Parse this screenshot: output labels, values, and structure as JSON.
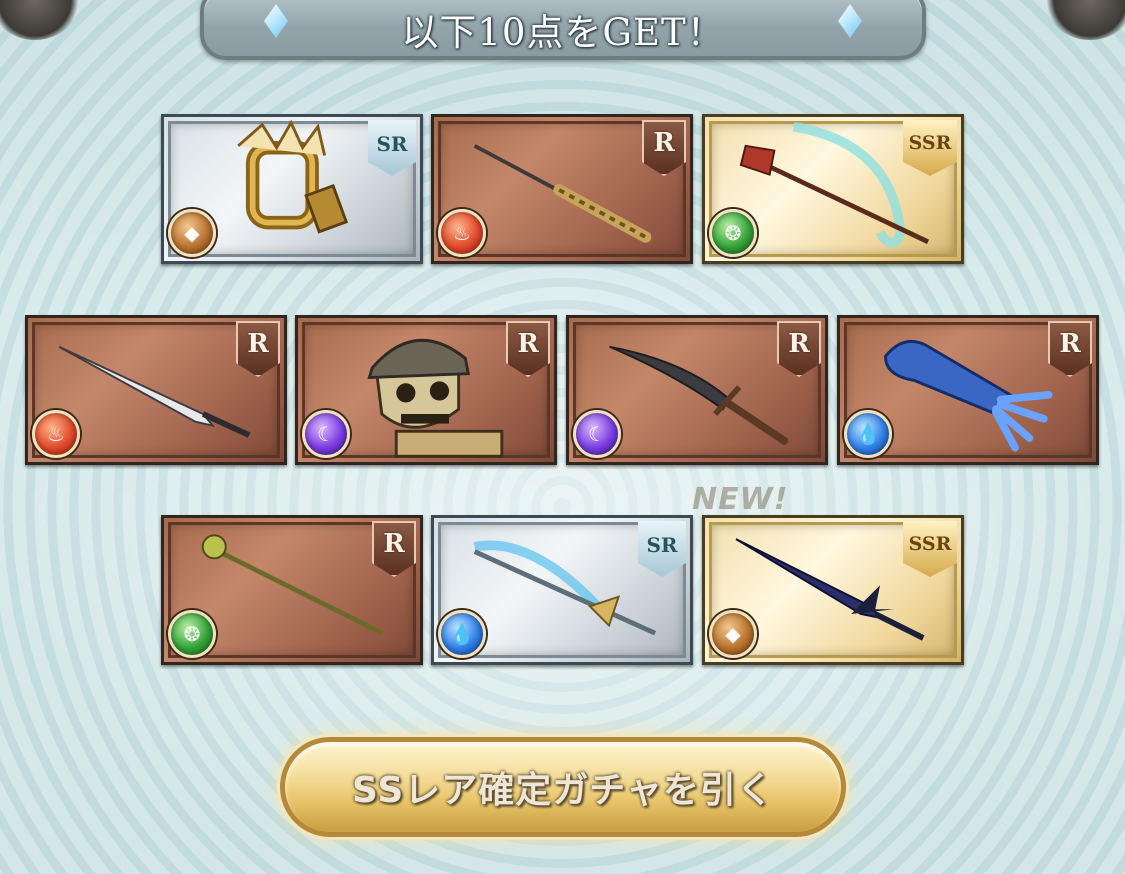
{
  "header": {
    "title": "以下10点をGET！"
  },
  "cards": [
    {
      "rarity": "SR",
      "element": "earth",
      "weapon": "claw"
    },
    {
      "rarity": "R",
      "element": "fire",
      "weapon": "spear"
    },
    {
      "rarity": "SSR",
      "element": "wind",
      "weapon": "halberd"
    },
    {
      "rarity": "R",
      "element": "fire",
      "weapon": "greatsword"
    },
    {
      "rarity": "R",
      "element": "dark",
      "weapon": "skull-helm"
    },
    {
      "rarity": "R",
      "element": "dark",
      "weapon": "dagger"
    },
    {
      "rarity": "R",
      "element": "water",
      "weapon": "gauntlet"
    },
    {
      "rarity": "R",
      "element": "wind",
      "weapon": "staff"
    },
    {
      "rarity": "SR",
      "element": "water",
      "weapon": "spear"
    },
    {
      "rarity": "SSR",
      "element": "earth",
      "weapon": "sword"
    }
  ],
  "new_badge": "NEW!",
  "draw_button": {
    "label": "SSレア確定ガチャを引く"
  }
}
